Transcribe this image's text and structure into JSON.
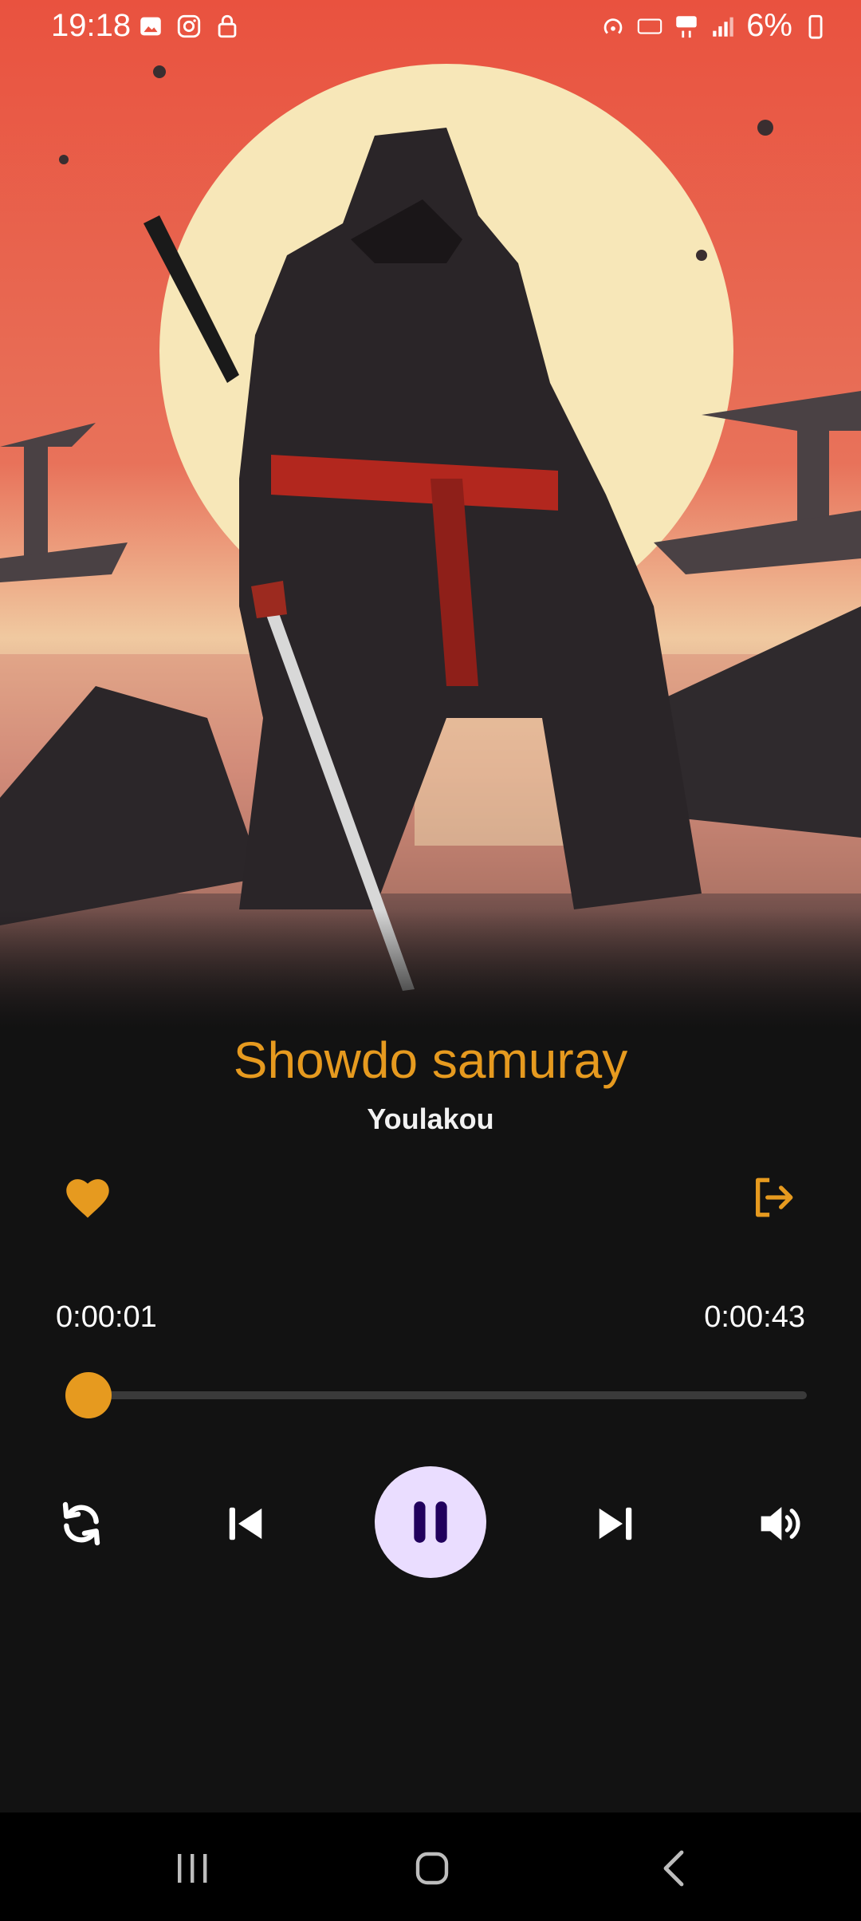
{
  "status_bar": {
    "time": "19:18",
    "battery": "6%",
    "icons": [
      "gallery-icon",
      "instagram-icon",
      "lock-icon",
      "hotspot-icon",
      "volte-icon",
      "5g-icon",
      "signal-icon",
      "battery-icon"
    ]
  },
  "track": {
    "title": "Showdo samuray",
    "artist": "Youlakou"
  },
  "playback": {
    "elapsed": "0:00:01",
    "total": "0:00:43",
    "progress_fraction": 0.023,
    "state": "playing"
  },
  "colors": {
    "accent": "#E69A1F",
    "background": "#121212",
    "play_button_bg": "#EADDFF",
    "play_icon": "#21005D"
  },
  "controls": [
    "repeat-icon",
    "skip-previous-icon",
    "pause-icon",
    "skip-next-icon",
    "volume-icon"
  ],
  "nav": [
    "recent-apps-icon",
    "home-icon",
    "back-icon"
  ]
}
